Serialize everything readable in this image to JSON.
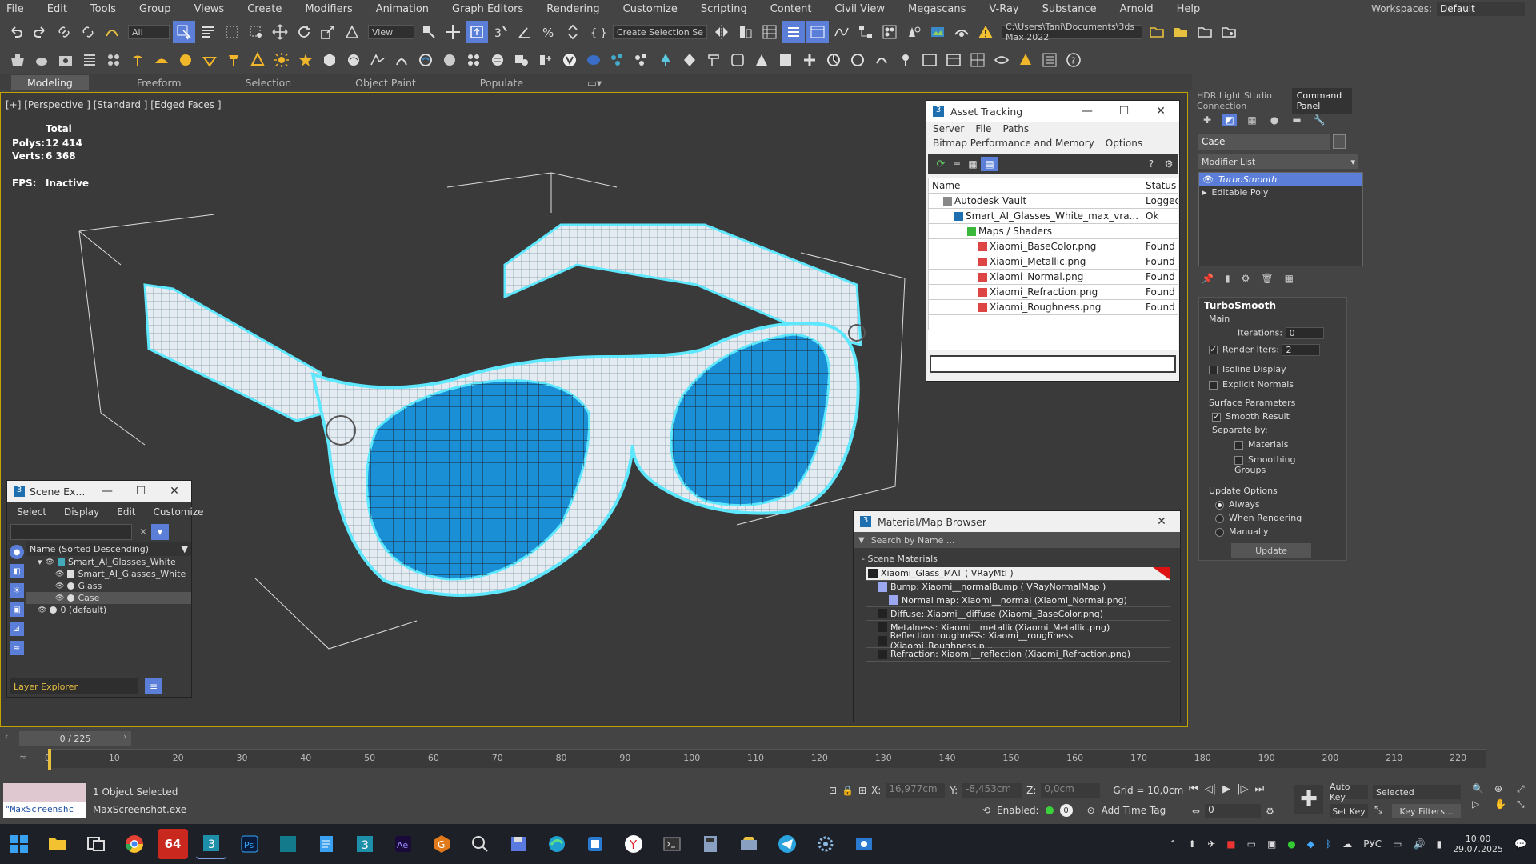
{
  "menu": [
    "File",
    "Edit",
    "Tools",
    "Group",
    "Views",
    "Create",
    "Modifiers",
    "Animation",
    "Graph Editors",
    "Rendering",
    "Customize",
    "Scripting",
    "Content",
    "Civil View",
    "Megascans",
    "V-Ray",
    "Substance",
    "Arnold",
    "Help"
  ],
  "workspace": {
    "label": "Workspaces:",
    "value": "Default"
  },
  "toolbar": {
    "filter": "All",
    "ref_coord": "View",
    "selection_set": "Create Selection Se",
    "path": "C:\\Users\\Tani\\Documents\\3ds Max 2022"
  },
  "ribbon_tabs": [
    "Modeling",
    "Freeform",
    "Selection",
    "Object Paint",
    "Populate"
  ],
  "viewport": {
    "label": "[+] [Perspective ] [Standard ] [Edged Faces ]",
    "stats": {
      "total": "Total",
      "polys_label": "Polys:",
      "polys": "12 414",
      "verts_label": "Verts:",
      "verts": "6 368",
      "fps_label": "FPS:",
      "fps": "Inactive"
    }
  },
  "asset_tracking": {
    "title": "Asset Tracking",
    "menu1": [
      "Server",
      "File",
      "Paths"
    ],
    "menu2": [
      "Bitmap Performance and Memory",
      "Options"
    ],
    "col_name": "Name",
    "col_status": "Status",
    "rows": [
      {
        "name": "Autodesk Vault",
        "status": "Logged Ou"
      },
      {
        "name": "Smart_AI_Glasses_White_max_vra...",
        "status": "Ok"
      },
      {
        "name": "Maps / Shaders",
        "status": ""
      },
      {
        "name": "Xiaomi_BaseColor.png",
        "status": "Found"
      },
      {
        "name": "Xiaomi_Metallic.png",
        "status": "Found"
      },
      {
        "name": "Xiaomi_Normal.png",
        "status": "Found"
      },
      {
        "name": "Xiaomi_Refraction.png",
        "status": "Found"
      },
      {
        "name": "Xiaomi_Roughness.png",
        "status": "Found"
      }
    ]
  },
  "scene_explorer": {
    "title": "Scene Ex...",
    "menu": [
      "Select",
      "Display",
      "Edit",
      "Customize"
    ],
    "header": "Name (Sorted Descending)",
    "items": [
      "Smart_AI_Glasses_White",
      "Smart_AI_Glasses_White",
      "Glass",
      "Case",
      "0 (default)"
    ],
    "footer": "Layer Explorer"
  },
  "material_browser": {
    "title": "Material/Map Browser",
    "search_placeholder": "Search by Name ...",
    "section": "- Scene Materials",
    "items": [
      "Xiaomi_Glass_MAT  ( VRayMtl )",
      "Bump: Xiaomi__normalBump  ( VRayNormalMap )",
      "Normal map: Xiaomi__normal (Xiaomi_Normal.png)",
      "Diffuse: Xiaomi__diffuse (Xiaomi_BaseColor.png)",
      "Metalness: Xiaomi__metallic(Xiaomi_Metallic.png)",
      "Reflection roughness: Xiaomi__roughness (Xiaomi_Roughness.p...",
      "Refraction: Xiaomi__reflection (Xiaomi_Refraction.png)"
    ]
  },
  "command_panel": {
    "tabs": [
      "HDR Light Studio Connection",
      "Command Panel"
    ],
    "object_name": "Case",
    "modifier_list": "Modifier List",
    "stack": [
      "TurboSmooth",
      "Editable Poly"
    ],
    "turbosmooth": {
      "title": "TurboSmooth",
      "main": "Main",
      "iterations_label": "Iterations:",
      "iterations": "0",
      "render_iters_label": "Render Iters:",
      "render_iters": "2",
      "isoline": "Isoline Display",
      "explicit": "Explicit Normals",
      "surface": "Surface Parameters",
      "smooth": "Smooth Result",
      "separate": "Separate by:",
      "materials": "Materials",
      "smoothing": "Smoothing Groups",
      "update_options": "Update Options",
      "always": "Always",
      "when_rendering": "When Rendering",
      "manually": "Manually",
      "update": "Update"
    }
  },
  "timeline": {
    "frame": "0 / 225",
    "ticks": [
      "0",
      "10",
      "20",
      "30",
      "40",
      "50",
      "60",
      "70",
      "80",
      "90",
      "100",
      "110",
      "120",
      "130",
      "140",
      "150",
      "160",
      "170",
      "180",
      "190",
      "200",
      "210",
      "220"
    ]
  },
  "status": {
    "script": "\"MaxScreenshc",
    "selected": "1 Object Selected",
    "app": "MaxScreenshot.exe",
    "x_label": "X:",
    "x": "16,977cm",
    "y_label": "Y:",
    "y": "-8,453cm",
    "z_label": "Z:",
    "z": "0,0cm",
    "grid": "Grid = 10,0cm",
    "enabled": "Enabled:",
    "add_time_tag": "Add Time Tag",
    "auto_key": "Auto Key",
    "set_key": "Set Key",
    "selected_drop": "Selected",
    "key_filters": "Key Filters...",
    "frame_field": "0"
  },
  "taskbar": {
    "lang": "РУС",
    "time": "10:00",
    "date": "29.07.2025",
    "badge": "64"
  },
  "colors": {
    "accent_yellow": "#c2a300",
    "glass_blue": "#1a8fd6",
    "wire_cyan": "#5ee8ff",
    "select_blue": "#5b7fd8"
  }
}
